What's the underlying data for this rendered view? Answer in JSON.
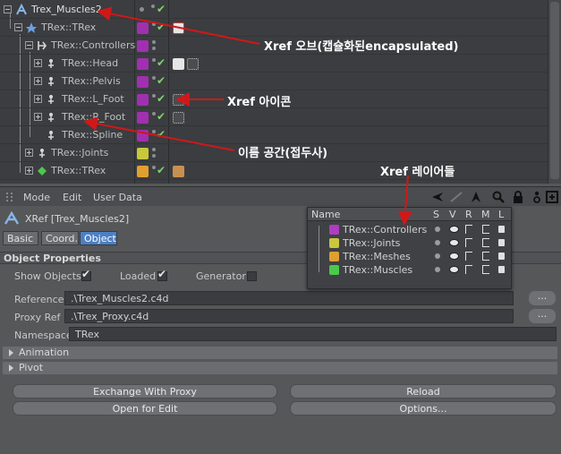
{
  "object_manager": {
    "rows": [
      {
        "name": "Trex_Muscles2"
      },
      {
        "name": "TRex::TRex"
      },
      {
        "name": "TRex::Controllers"
      },
      {
        "name": "TRex::Head"
      },
      {
        "name": "TRex::Pelvis"
      },
      {
        "name": "TRex::L_Foot"
      },
      {
        "name": "TRex::R_Foot"
      },
      {
        "name": "TRex::Spline"
      },
      {
        "name": "TRex::Joints"
      },
      {
        "name": "TRex::TRex"
      }
    ]
  },
  "annotations": {
    "xref_object": "Xref 오브(캡슐화된encapsulated)",
    "xref_icon": "Xref 아이콘",
    "namespace": "이름 공간(접두사)",
    "xref_layers": "Xref 레이어들"
  },
  "attribute_manager": {
    "menu": {
      "mode": "Mode",
      "edit": "Edit",
      "user_data": "User Data"
    },
    "title": "XRef [Trex_Muscles2]",
    "tabs": [
      "Basic",
      "Coord.",
      "Object"
    ],
    "section_title": "Object Properties",
    "show_objects_label": "Show Objects",
    "show_objects_checked": true,
    "loaded_label": "Loaded",
    "loaded_checked": true,
    "generator_label": "Generator",
    "generator_checked": false,
    "reference_label": "Reference",
    "reference_value": ".\\Trex_Muscles2.c4d",
    "proxy_ref_label": "Proxy Ref",
    "proxy_ref_value": ".\\Trex_Proxy.c4d",
    "namespace_label": "Namespace",
    "namespace_value": "TRex",
    "browse_label": "...",
    "animation_label": "Animation",
    "pivot_label": "Pivot",
    "buttons": {
      "exchange_with_proxy": "Exchange With Proxy",
      "reload": "Reload",
      "open_for_edit": "Open for Edit",
      "options": "Options..."
    }
  },
  "layers": {
    "columns": {
      "name": "Name",
      "s": "S",
      "v": "V",
      "r": "R",
      "m": "M",
      "l": "L"
    },
    "items": [
      {
        "name": "TRex::Controllers",
        "color": "#b03cc0"
      },
      {
        "name": "TRex::Joints",
        "color": "#c8c83c"
      },
      {
        "name": "TRex::Meshes",
        "color": "#e0a030"
      },
      {
        "name": "TRex::Muscles",
        "color": "#4cc84c"
      }
    ]
  },
  "colors": {
    "accent_tab": "#4d7fc4",
    "arrow": "#d01818",
    "check_green": "#7fd36a"
  }
}
